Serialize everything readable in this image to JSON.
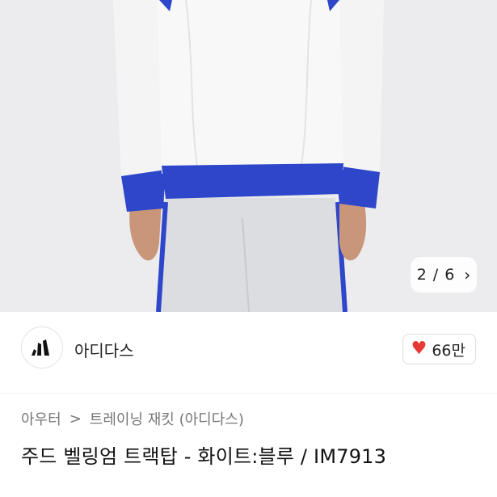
{
  "image": {
    "pager": {
      "current": "2",
      "separator": "/",
      "total": "6"
    },
    "colors": {
      "jacket": "#f6f6f7",
      "cuff_blue": "#2e46c9",
      "background": "#ececee",
      "skin": "#c9967a"
    },
    "icons": {
      "next": "chevron-right-icon"
    }
  },
  "seller": {
    "name": "아디다스",
    "avatar_icon": "adidas-logo-icon",
    "likes": "66만",
    "like_icon": "heart-icon",
    "like_color": "#e53935"
  },
  "breadcrumb": {
    "items": [
      "아우터",
      "트레이닝 재킷 (아디다스)"
    ],
    "separator": ">"
  },
  "product": {
    "title": "주드 벨링엄 트랙탑 - 화이트:블루 / IM7913"
  }
}
